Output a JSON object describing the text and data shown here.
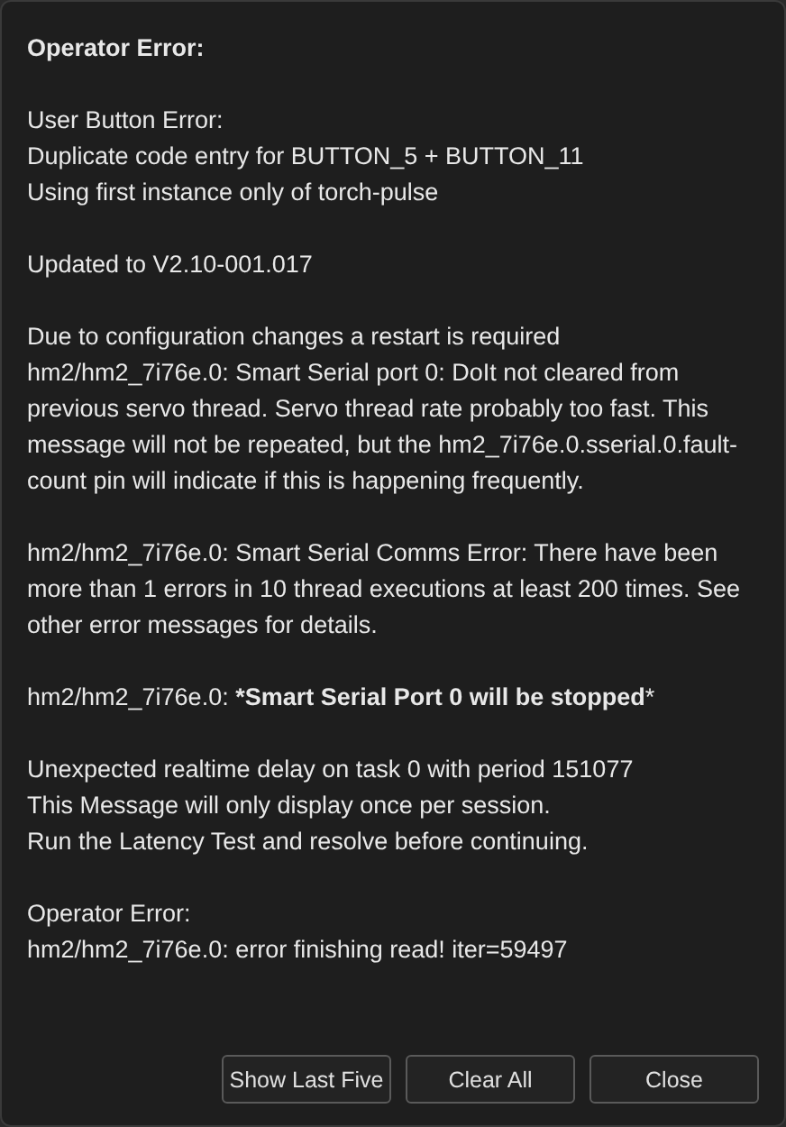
{
  "dialog": {
    "title": "Operator Error:",
    "messages": [
      {
        "lines": [
          "User Button Error:",
          "Duplicate code entry for BUTTON_5 + BUTTON_11",
          "Using first instance only of torch-pulse"
        ]
      },
      {
        "lines": [
          "Updated to V2.10-001.017"
        ]
      },
      {
        "lines": [
          "Due to configuration changes a restart is required",
          "hm2/hm2_7i76e.0: Smart Serial port 0: DoIt not cleared from previous servo thread. Servo thread rate probably too fast. This message will not be repeated, but the hm2_7i76e.0.sserial.0.fault-count pin will indicate if this is happening frequently."
        ]
      },
      {
        "lines": [
          "hm2/hm2_7i76e.0: Smart Serial Comms Error: There have been more than 1 errors in 10 thread executions at least 200 times. See other error messages for details."
        ]
      },
      {
        "lines": [
          "hm2/hm2_7i76e.0: ***Smart Serial Port 0 will be stopped***"
        ]
      },
      {
        "lines": [
          "Unexpected realtime delay on task 0 with period 151077",
          "This Message will only display once per session.",
          "Run the Latency Test and resolve before continuing."
        ]
      },
      {
        "lines": [
          "Operator Error:",
          "hm2/hm2_7i76e.0: error finishing read! iter=59497"
        ]
      }
    ],
    "buttons": [
      "Show Last Five",
      "Clear All",
      "Close"
    ]
  }
}
